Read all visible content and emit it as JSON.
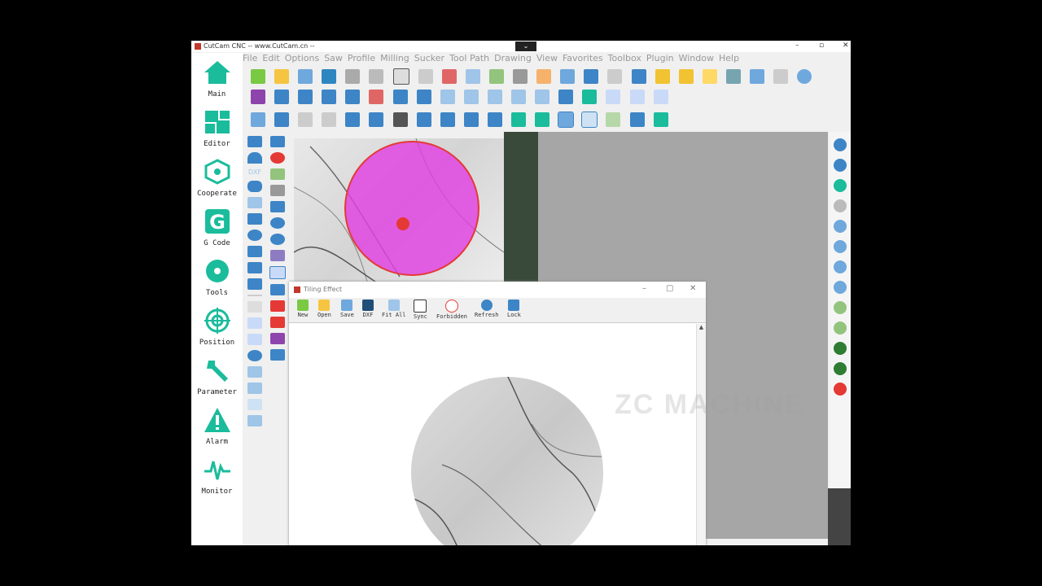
{
  "window": {
    "title": "CutCam CNC -- www.CutCam.cn --",
    "dropdown_glyph": "⌄",
    "minimize": "–",
    "maximize": "▫",
    "close": "✕"
  },
  "menu": [
    "File",
    "Edit",
    "Options",
    "Saw",
    "Profile",
    "Milling",
    "Sucker",
    "Tool Path",
    "Drawing",
    "View",
    "Favorites",
    "Toolbox",
    "Plugin",
    "Window",
    "Help"
  ],
  "nav": [
    {
      "label": "Main",
      "icon": "home-icon"
    },
    {
      "label": "Editor",
      "icon": "editor-grid-icon"
    },
    {
      "label": "Cooperate",
      "icon": "network-icon"
    },
    {
      "label": "G Code",
      "icon": "g-code-icon"
    },
    {
      "label": "Tools",
      "icon": "saw-blade-icon"
    },
    {
      "label": "Position",
      "icon": "crosshair-icon"
    },
    {
      "label": "Parameter",
      "icon": "wrench-icon"
    },
    {
      "label": "Alarm",
      "icon": "warning-icon"
    },
    {
      "label": "Monitor",
      "icon": "pulse-icon"
    }
  ],
  "left_tools_label": "DXF",
  "tiling": {
    "title": "Tiling Effect",
    "buttons": [
      {
        "label": "New",
        "icon": "new-icon"
      },
      {
        "label": "Open",
        "icon": "open-icon"
      },
      {
        "label": "Save",
        "icon": "save-icon"
      },
      {
        "label": "DXF",
        "icon": "dxf-icon"
      },
      {
        "label": "Fit All",
        "icon": "fit-all-icon"
      },
      {
        "label": "Sync",
        "icon": "sync-icon"
      },
      {
        "label": "Forbidden",
        "icon": "forbidden-icon"
      },
      {
        "label": "Refresh",
        "icon": "refresh-icon"
      },
      {
        "label": "Lock",
        "icon": "lock-icon"
      }
    ],
    "minimize": "–",
    "maximize": "▢",
    "close": "✕"
  },
  "watermark": "ZC MACHINE",
  "colors": {
    "accent": "#1abc9c",
    "selection": "#e040e0",
    "marble": "#d8d8d8"
  }
}
